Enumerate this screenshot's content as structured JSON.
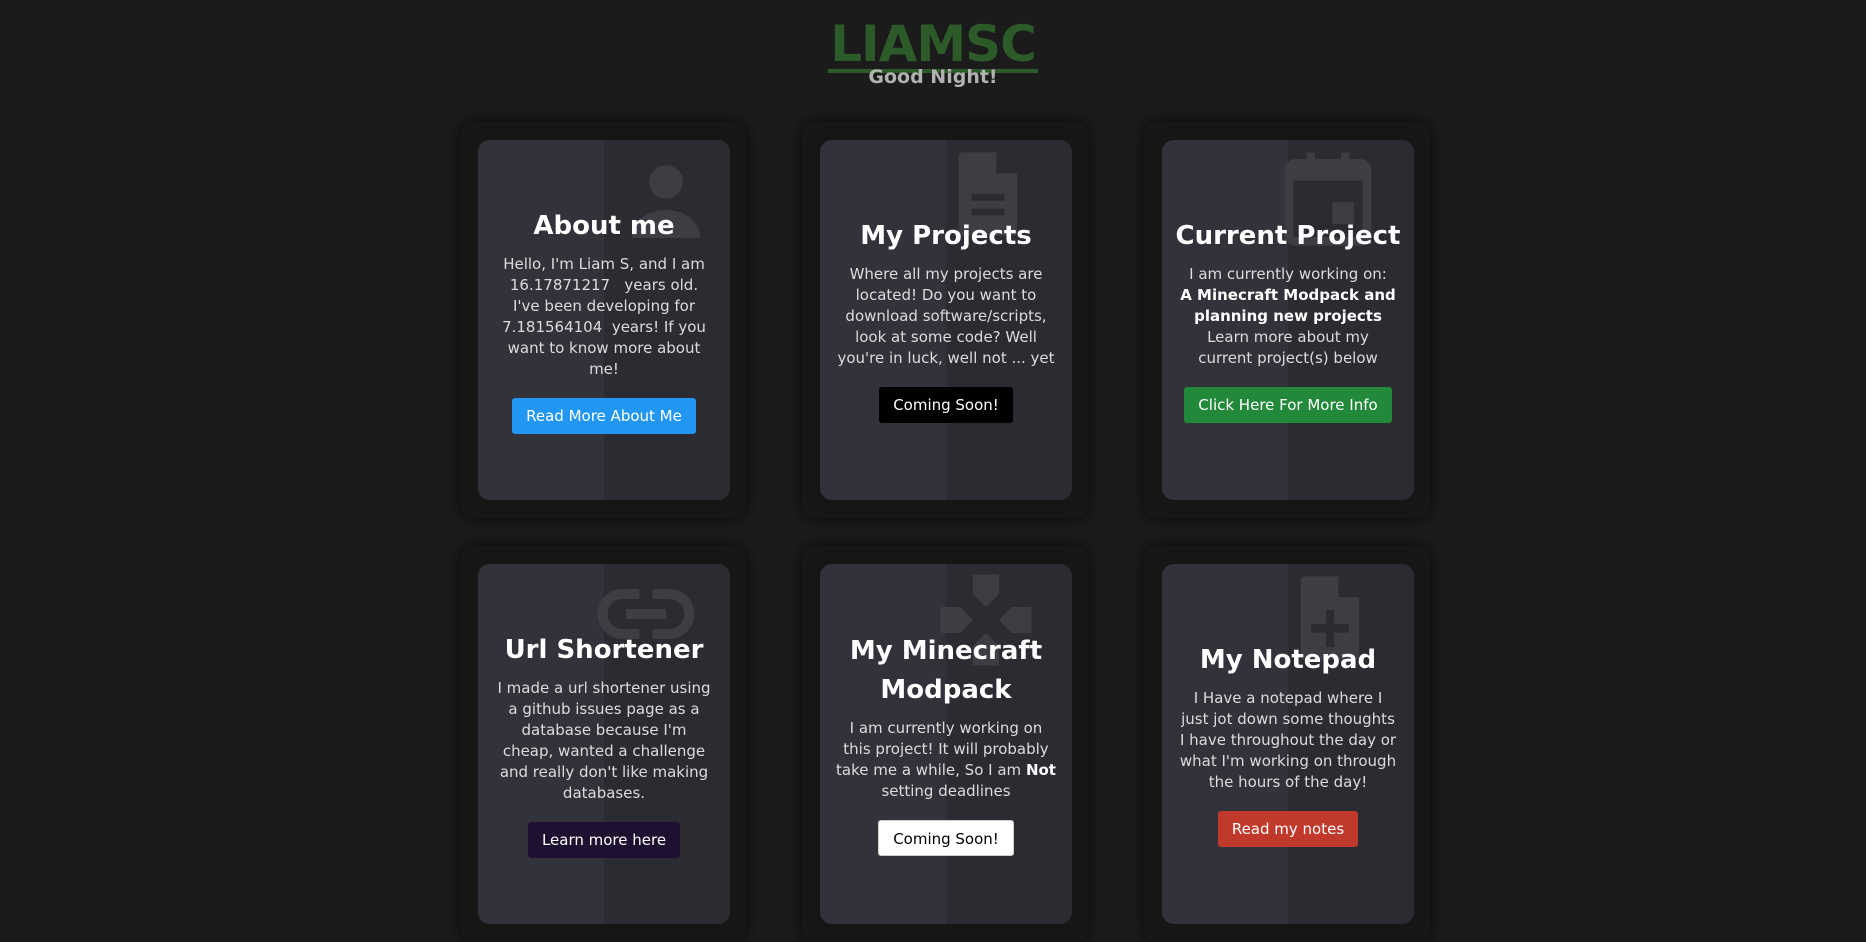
{
  "header": {
    "logo": "LIAMSC",
    "greeting": "Good Night!"
  },
  "cards": [
    {
      "title": "About me",
      "desc_parts": [
        "Hello, I'm Liam S, and I am",
        "16.17871217",
        "years old.",
        "I've been developing for",
        "7.181564104",
        "years! If you want to know more about me!"
      ],
      "button": "Read More About Me",
      "icon": "person-icon",
      "button_color": "#2196f3"
    },
    {
      "title": "My Projects",
      "desc": "Where all my projects are located! Do you want to download software/scripts, look at some code? Well you're in luck, well not ... yet",
      "button": "Coming Soon!",
      "icon": "document-icon",
      "button_color": "#000000"
    },
    {
      "title": "Current Project",
      "desc_parts": [
        "I am currently working on:",
        "A Minecraft Modpack and planning new projects",
        "Learn more about my current project(s) below"
      ],
      "button": "Click Here For More Info",
      "icon": "calendar-icon",
      "button_color": "#23893a"
    },
    {
      "title": "Url Shortener",
      "desc": "I made a url shortener using a github issues page as a database because I'm cheap, wanted a challenge and really don't like making databases.",
      "button": "Learn more here",
      "icon": "link-icon",
      "button_color": "#1d1030"
    },
    {
      "title": "My Minecraft Modpack",
      "desc_parts": [
        "I am currently working on this project! It will probably take me a while, So I am",
        "Not",
        "setting deadlines"
      ],
      "button": "Coming Soon!",
      "icon": "gamepad-icon",
      "button_color": "#ffffff"
    },
    {
      "title": "My Notepad",
      "desc": "I Have a notepad where I just jot down some thoughts I have throughout the day or what I'm working on through the hours of the day!",
      "button": "Read my notes",
      "icon": "note-add-icon",
      "button_color": "#c0392b"
    }
  ]
}
